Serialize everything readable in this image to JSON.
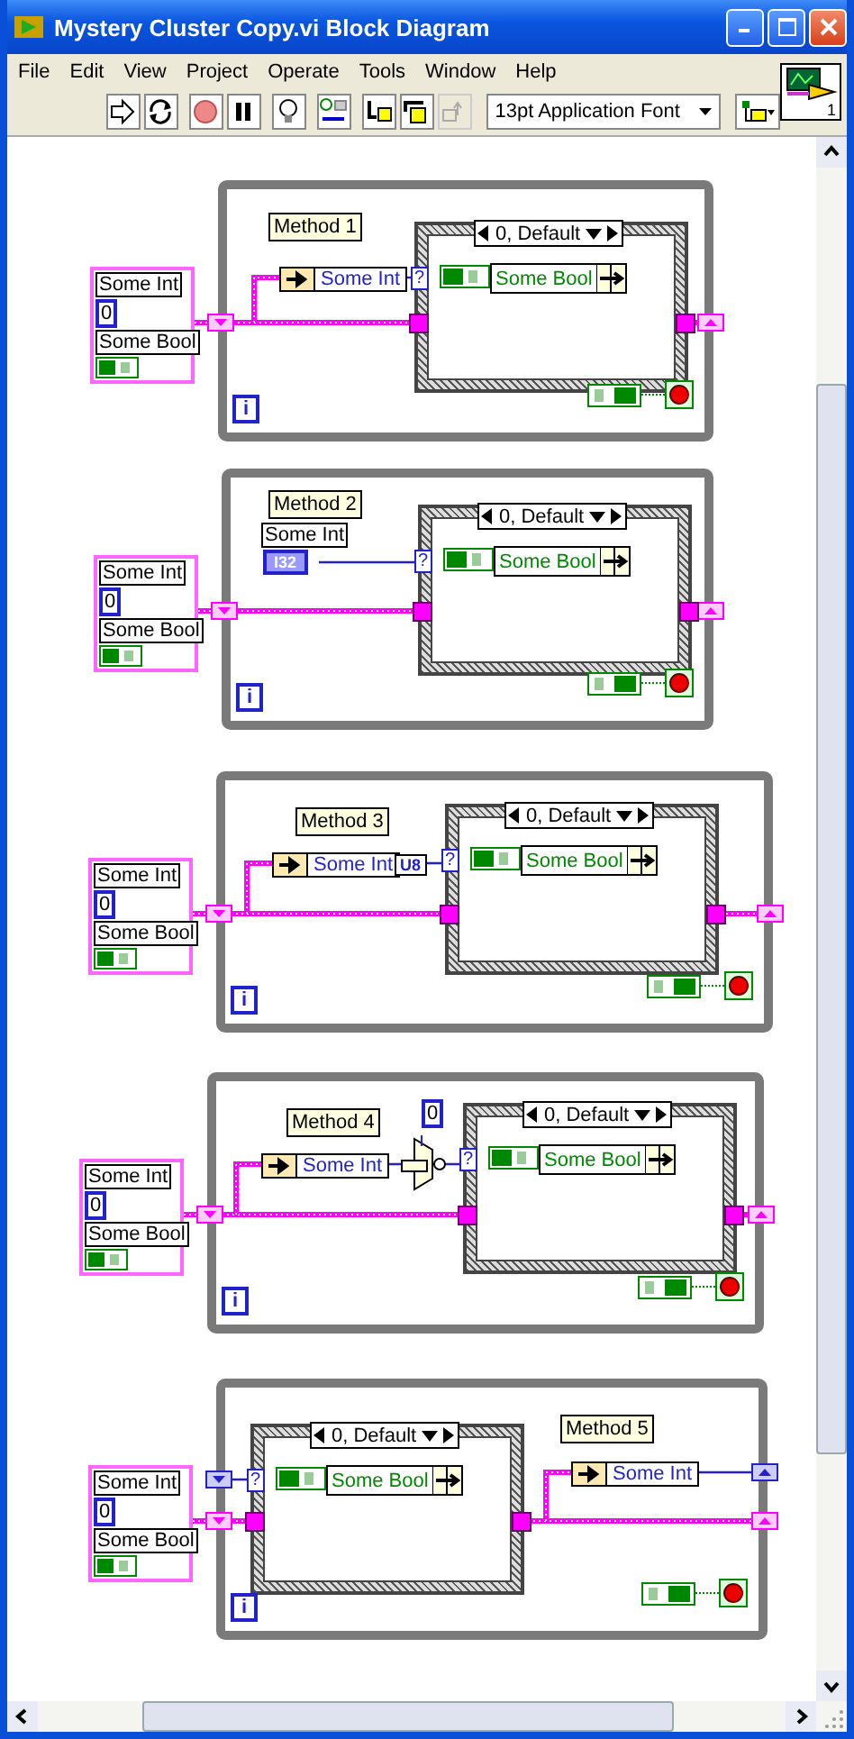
{
  "window": {
    "title": "Mystery Cluster Copy.vi Block Diagram"
  },
  "menu": [
    "File",
    "Edit",
    "View",
    "Project",
    "Operate",
    "Tools",
    "Window",
    "Help"
  ],
  "toolbar": {
    "font": "13pt Application Font"
  },
  "connector_pane": {
    "label": "1"
  },
  "methods": [
    {
      "kind": "unbundle",
      "label": "Method 1",
      "cluster": {
        "int_label": "Some Int",
        "int_value": "0",
        "bool_label": "Some Bool"
      },
      "element": "Some Int",
      "case_label": "0, Default",
      "selector": "?",
      "bundle_element": "Some Bool",
      "iteration": "i"
    },
    {
      "kind": "terminal",
      "label": "Method 2",
      "cluster": {
        "int_label": "Some Int",
        "int_value": "0",
        "bool_label": "Some Bool"
      },
      "element": "Some Int",
      "terminal_type": "I32",
      "case_label": "0, Default",
      "selector": "?",
      "bundle_element": "Some Bool",
      "iteration": "i"
    },
    {
      "kind": "convert",
      "label": "Method 3",
      "cluster": {
        "int_label": "Some Int",
        "int_value": "0",
        "bool_label": "Some Bool"
      },
      "element": "Some Int",
      "conversion": "U8",
      "case_label": "0, Default",
      "selector": "?",
      "bundle_element": "Some Bool",
      "iteration": "i"
    },
    {
      "kind": "select",
      "label": "Method 4",
      "cluster": {
        "int_label": "Some Int",
        "int_value": "0",
        "bool_label": "Some Bool"
      },
      "element": "Some Int",
      "select_value": "0",
      "case_label": "0, Default",
      "selector": "?",
      "bundle_element": "Some Bool",
      "iteration": "i"
    },
    {
      "kind": "after",
      "label": "Method 5",
      "cluster": {
        "int_label": "Some Int",
        "int_value": "0",
        "bool_label": "Some Bool"
      },
      "element": "Some Int",
      "case_label": "0, Default",
      "selector": "?",
      "bundle_element": "Some Bool",
      "iteration": "i"
    }
  ]
}
